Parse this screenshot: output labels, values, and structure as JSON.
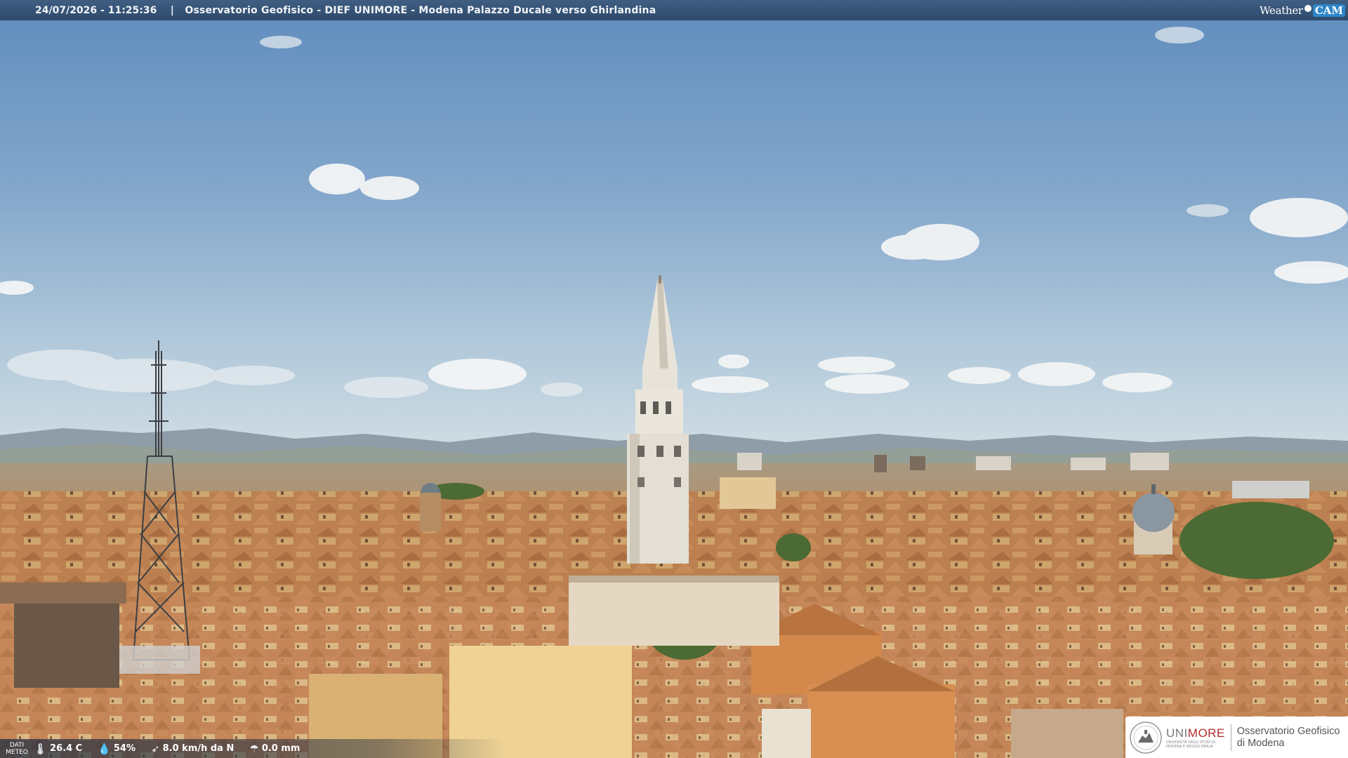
{
  "header": {
    "datetime": "24/07/2026 - 11:25:36",
    "separator": "|",
    "title": "Osservatorio Geofisico - DIEF UNIMORE - Modena Palazzo Ducale verso Ghirlandina",
    "brand_part1": "Weather",
    "brand_part2": "CAM"
  },
  "meteo": {
    "label_line1": "DATI",
    "label_line2": "METEO",
    "temperature": "26.4 C",
    "temperature_icon": "thermometer-icon",
    "humidity": "54%",
    "humidity_icon": "droplet-icon",
    "wind": "8.0 km/h da N",
    "wind_icon": "wind-icon",
    "rain": "0.0 mm",
    "rain_icon": "rain-icon"
  },
  "logo": {
    "uni_prefix": "UNI",
    "uni_suffix": "MORE",
    "uni_sub1": "UNIVERSITÀ DEGLI STUDI DI",
    "uni_sub2": "MODENA E REGGIO EMILIA",
    "observatory_line1": "Osservatorio Geofisico",
    "observatory_line2": "di Modena"
  },
  "colors": {
    "sky_top": "#6f98c3",
    "sky_bottom": "#c9d9e2",
    "roofs": "#b97a4c",
    "tower": "#e6e1d6",
    "header_bar": "#36537a",
    "uni_red": "#b32b2b"
  }
}
